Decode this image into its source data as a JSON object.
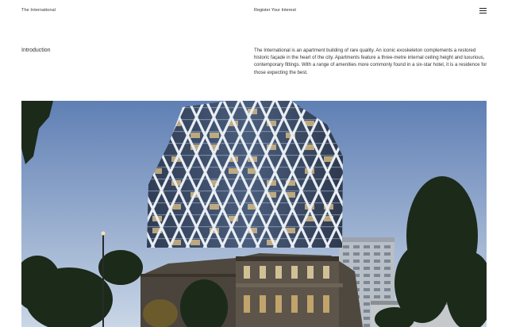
{
  "header": {
    "site_title": "The International",
    "register_label": "Register Your Interest",
    "menu_icon": "hamburger-menu-icon"
  },
  "intro": {
    "heading": "Introduction",
    "body": "The International is an apartment building of rare quality. An iconic exoskeleton complements a restored historic façade in the heart of the city. Apartments feature a three-metre internal ceiling height and luxurious, contemporary fittings. With a range of amenities more commonly found in a six-star hotel, it is a residence for those expecting the best."
  },
  "colors": {
    "sky_top": "#5f7fb4",
    "sky_bottom": "#c9d6e6",
    "exoskeleton": "#e8eef4",
    "glass": "#3b4a63",
    "warm_light": "#e7c88a",
    "tree": "#1c2a1a",
    "heritage": "#5a5246"
  }
}
